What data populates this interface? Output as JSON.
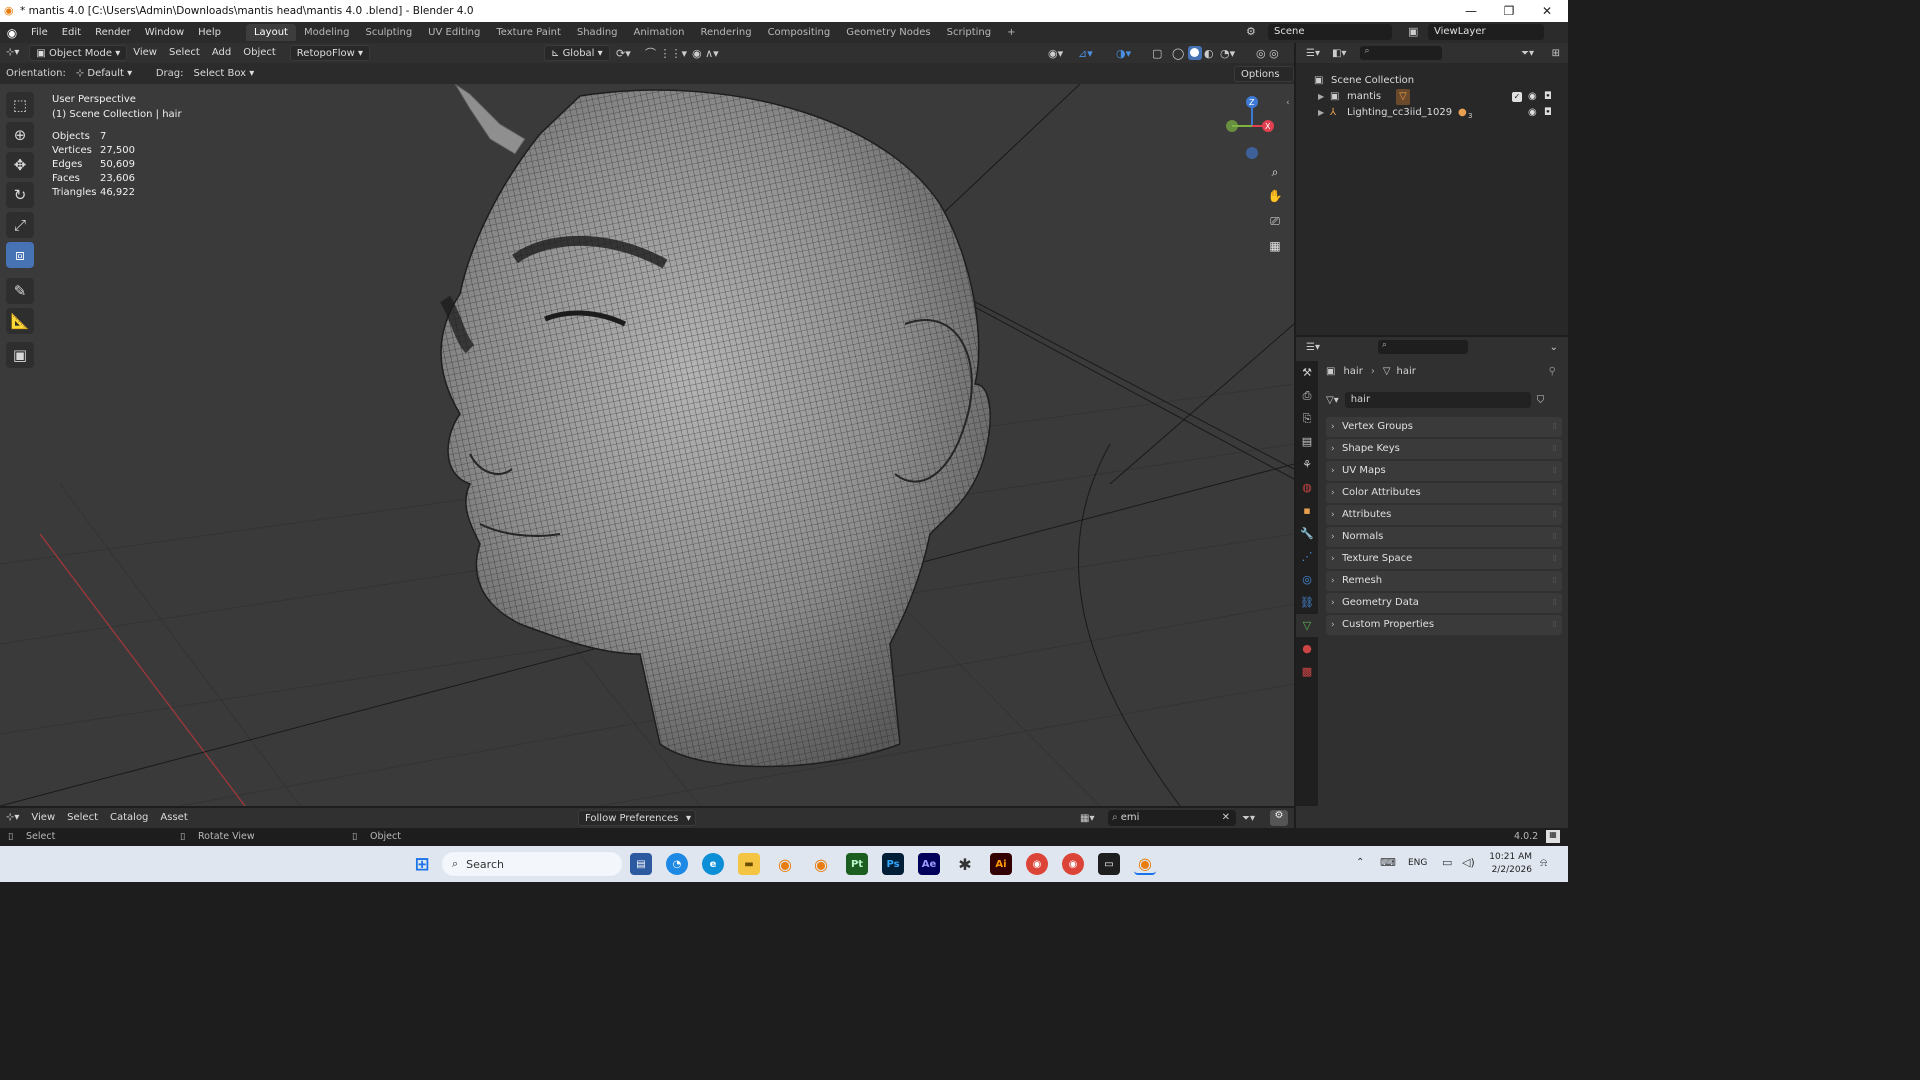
{
  "window": {
    "title": "* mantis 4.0  [C:\\Users\\Admin\\Downloads\\mantis head\\mantis 4.0 .blend] - Blender 4.0",
    "minimize": "—",
    "maximize": "❐",
    "close": "✕"
  },
  "menu": [
    "File",
    "Edit",
    "Render",
    "Window",
    "Help"
  ],
  "workspaces": [
    "Layout",
    "Modeling",
    "Sculpting",
    "UV Editing",
    "Texture Paint",
    "Shading",
    "Animation",
    "Rendering",
    "Compositing",
    "Geometry Nodes",
    "Scripting"
  ],
  "active_workspace": "Layout",
  "add_workspace": "+",
  "scene_name": "Scene",
  "view_layer": "ViewLayer",
  "viewport_header": {
    "mode": "Object Mode",
    "menus": [
      "View",
      "Select",
      "Add",
      "Object"
    ],
    "addon": "RetopoFlow",
    "transform_orientation": "Global"
  },
  "tool_header": {
    "orientation_label": "Orientation:",
    "orientation_value": "Default",
    "drag_label": "Drag:",
    "drag_value": "Select Box",
    "options": "Options"
  },
  "viewport": {
    "perspective": "User Perspective",
    "collection_info": "(1) Scene Collection | hair",
    "stats": [
      {
        "label": "Objects",
        "value": "7"
      },
      {
        "label": "Vertices",
        "value": "27,500"
      },
      {
        "label": "Edges",
        "value": "50,609"
      },
      {
        "label": "Faces",
        "value": "23,606"
      },
      {
        "label": "Triangles",
        "value": "46,922"
      }
    ],
    "gizmo": {
      "z": "Z",
      "x": "X"
    }
  },
  "outliner": {
    "root": "Scene Collection",
    "items": [
      {
        "name": "mantis"
      },
      {
        "name": "Lighting_cc3iid_1029",
        "badge": "3"
      }
    ]
  },
  "properties": {
    "breadcrumb_object": "hair",
    "breadcrumb_data": "hair",
    "datablock": "hair",
    "panels": [
      "Vertex Groups",
      "Shape Keys",
      "UV Maps",
      "Color Attributes",
      "Attributes",
      "Normals",
      "Texture Space",
      "Remesh",
      "Geometry Data",
      "Custom Properties"
    ]
  },
  "asset_bar": {
    "menus": [
      "View",
      "Select",
      "Catalog",
      "Asset"
    ],
    "import_method": "Follow Preferences",
    "search_value": "emi"
  },
  "status_bar": {
    "left": "Select",
    "middle": "Rotate View",
    "right": "Object",
    "version": "4.0.2"
  },
  "taskbar": {
    "search_placeholder": "Search",
    "language": "ENG",
    "time": "10:21 AM",
    "date": "2/2/2026",
    "apps": [
      "Pt",
      "Ps",
      "Ae",
      "Ai"
    ]
  },
  "colors": {
    "accent": "#4772b3",
    "axis_x": "#e04050",
    "axis_y": "#7cb342",
    "axis_z": "#3d7ad6",
    "blender_orange": "#e87d0d"
  }
}
